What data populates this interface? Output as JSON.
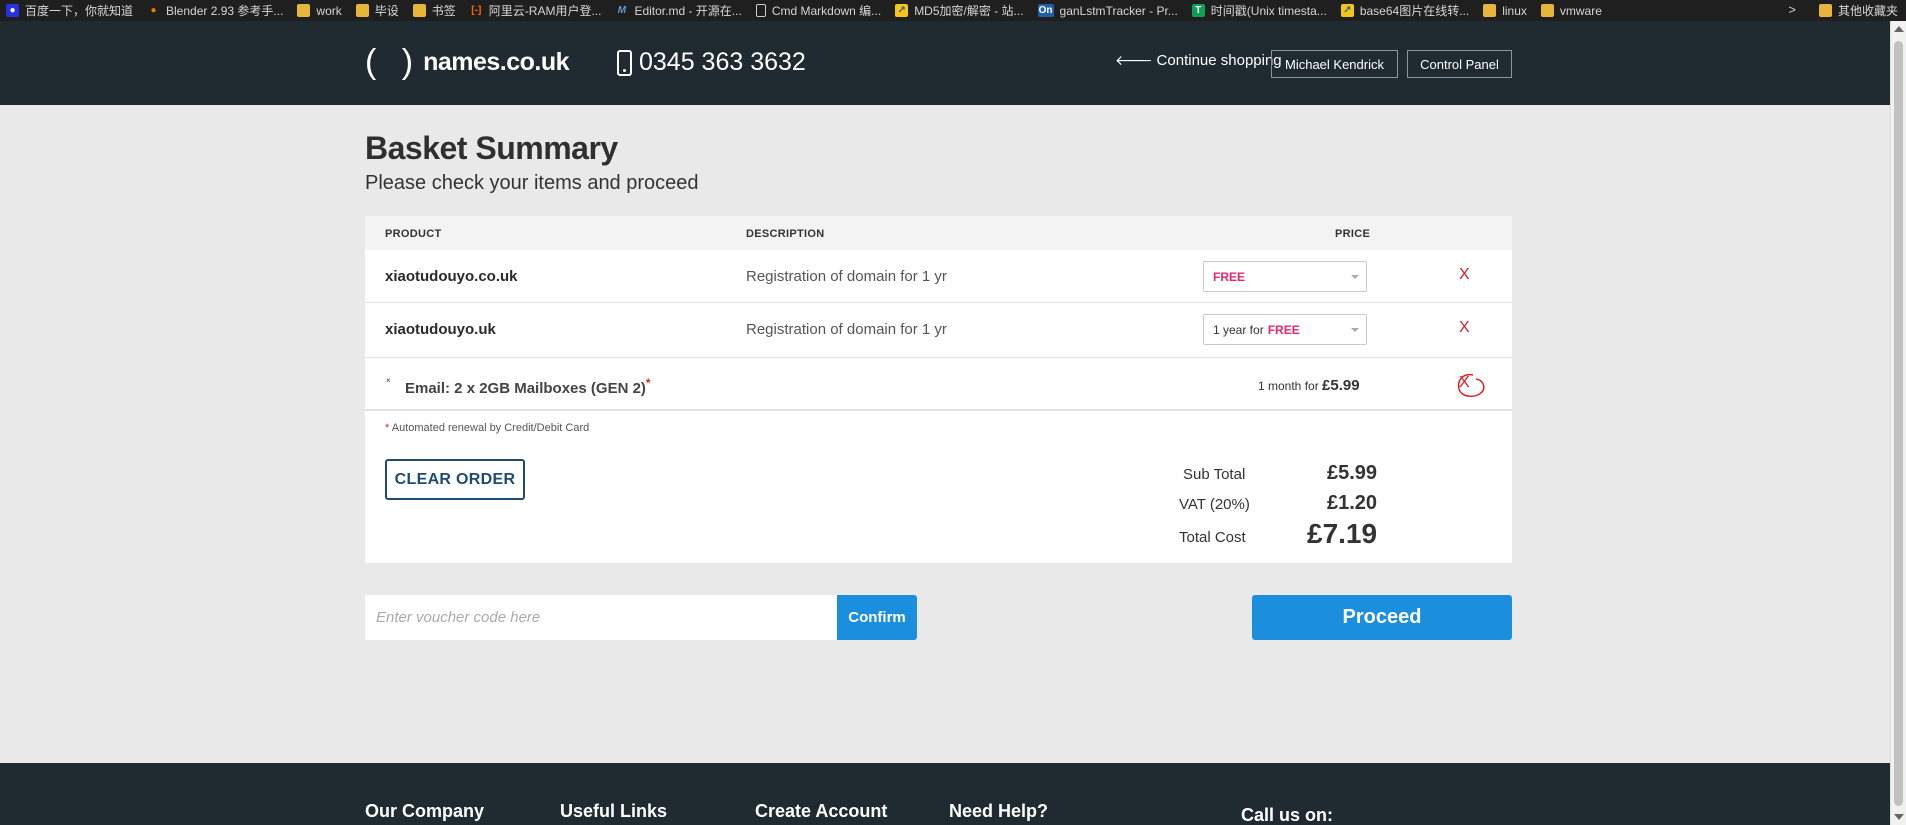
{
  "bookmarks": [
    {
      "label": "百度一下，你就知道",
      "icon": "baidu-icon",
      "color": "#2932e1"
    },
    {
      "label": "Blender 2.93 参考手...",
      "icon": "blender-icon",
      "color": "#e87d0d"
    },
    {
      "label": "work",
      "icon": "folder-icon",
      "color": "#e8b53b"
    },
    {
      "label": "毕设",
      "icon": "folder-icon",
      "color": "#e8b53b"
    },
    {
      "label": "书签",
      "icon": "folder-icon",
      "color": "#e8b53b"
    },
    {
      "label": "阿里云-RAM用户登...",
      "icon": "aliyun-icon",
      "color": "#ff6a00"
    },
    {
      "label": "Editor.md - 开源在...",
      "icon": "editor-md-icon",
      "color": "#2c73b8"
    },
    {
      "label": "Cmd Markdown 编...",
      "icon": "page-icon",
      "color": "#dddddd"
    },
    {
      "label": "MD5加密/解密 - 站...",
      "icon": "md5-icon",
      "color": "#f5c518"
    },
    {
      "label": "ganLstmTracker - Pr...",
      "icon": "overleaf-icon",
      "color": "#1f5fa8"
    },
    {
      "label": "时间戳(Unix timesta...",
      "icon": "timestamp-icon",
      "color": "#0f9d58"
    },
    {
      "label": "base64图片在线转...",
      "icon": "base64-icon",
      "color": "#f5c518"
    },
    {
      "label": "linux",
      "icon": "folder-icon",
      "color": "#e8b53b"
    },
    {
      "label": "vmware",
      "icon": "folder-icon",
      "color": "#e8b53b"
    }
  ],
  "bookmarks_more": ">",
  "bookmarks_other": "其他收藏夹",
  "header": {
    "logo": "names.co.uk",
    "logo_paren": "( )",
    "phone": "0345 363 3632",
    "continue_label": "Continue shopping",
    "account_label": "Michael Kendrick",
    "control_panel_label": "Control Panel"
  },
  "page": {
    "title": "Basket Summary",
    "subtitle": "Please check your items and proceed"
  },
  "table": {
    "columns": [
      "PRODUCT",
      "DESCRIPTION",
      "PRICE"
    ],
    "rows": [
      {
        "product": "xiaotudouyo.co.uk",
        "description": "Registration of domain for 1 yr",
        "price_prefix": "",
        "price_free": "FREE",
        "remove": "X"
      },
      {
        "product": "xiaotudouyo.uk",
        "description": "Registration of domain for 1 yr",
        "price_prefix": "1 year for",
        "price_free": "FREE",
        "remove": "X"
      }
    ],
    "email": {
      "toggle": "×",
      "label": "Email: 2 x 2GB Mailboxes (GEN 2)",
      "asterisk": "*",
      "price_prefix": "1 month for",
      "price": "£5.99",
      "remove": "X"
    }
  },
  "renewal_note": {
    "asterisk": "*",
    "text": "Automated renewal by Credit/Debit Card"
  },
  "clear_order_label": "CLEAR ORDER",
  "totals": {
    "sub_total_label": "Sub Total",
    "sub_total": "£5.99",
    "vat_label": "VAT (20%)",
    "vat": "£1.20",
    "total_label": "Total Cost",
    "total": "£7.19"
  },
  "voucher": {
    "placeholder": "Enter voucher code here",
    "confirm_label": "Confirm"
  },
  "proceed_label": "Proceed",
  "footer": {
    "columns": [
      "Our Company",
      "Useful Links",
      "Create Account",
      "Need Help?",
      "Call us on:"
    ]
  },
  "colors": {
    "accent": "#1b8fdd",
    "header_bg": "#202a31",
    "free": "#e5276f",
    "remove": "#d62030"
  }
}
